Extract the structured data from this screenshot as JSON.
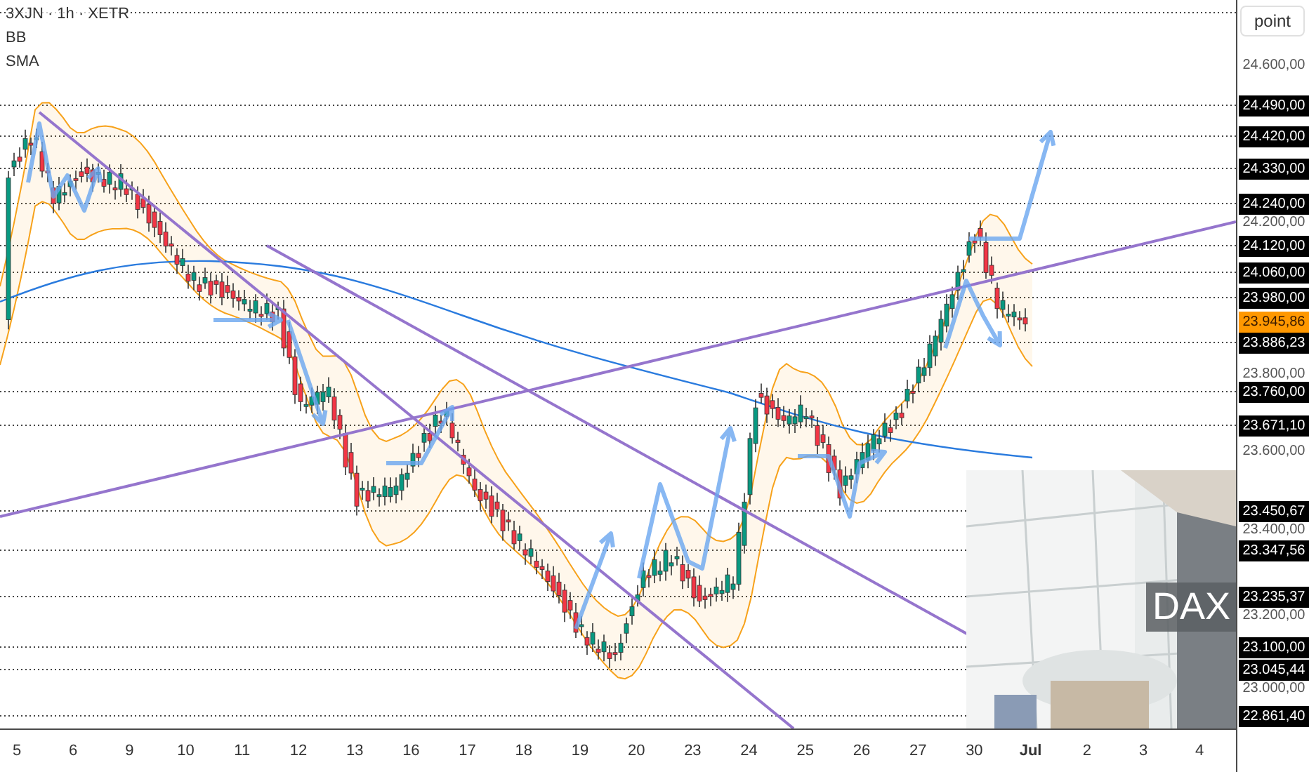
{
  "legend": {
    "symbol": "3XJN · 1h · XETR",
    "indicators": [
      "BB",
      "SMA"
    ]
  },
  "price_axis": {
    "unit": "point",
    "labels": [
      {
        "text": "24.600,00",
        "kind": "tick"
      },
      {
        "text": "24.490,00",
        "kind": "level"
      },
      {
        "text": "24.420,00",
        "kind": "level"
      },
      {
        "text": "24.330,00",
        "kind": "level"
      },
      {
        "text": "24.240,00",
        "kind": "level"
      },
      {
        "text": "24.200,00",
        "kind": "tick"
      },
      {
        "text": "24.120,00",
        "kind": "level"
      },
      {
        "text": "24.060,00",
        "kind": "level"
      },
      {
        "text": "23.980,00",
        "kind": "level"
      },
      {
        "text": "23.945,86",
        "kind": "current"
      },
      {
        "text": "23.886,23",
        "kind": "level"
      },
      {
        "text": "23.800,00",
        "kind": "tick"
      },
      {
        "text": "23.760,00",
        "kind": "level"
      },
      {
        "text": "23.671,10",
        "kind": "level"
      },
      {
        "text": "23.600,00",
        "kind": "tick"
      },
      {
        "text": "23.450,67",
        "kind": "level"
      },
      {
        "text": "23.400,00",
        "kind": "tick"
      },
      {
        "text": "23.347,56",
        "kind": "level"
      },
      {
        "text": "23.235,37",
        "kind": "level"
      },
      {
        "text": "23.200,00",
        "kind": "tick"
      },
      {
        "text": "23.100,00",
        "kind": "level"
      },
      {
        "text": "23.045,44",
        "kind": "level"
      },
      {
        "text": "23.000,00",
        "kind": "tick"
      },
      {
        "text": "22.861,40",
        "kind": "level"
      }
    ]
  },
  "time_axis": {
    "labels": [
      {
        "text": "5",
        "kind": "day"
      },
      {
        "text": "6",
        "kind": "day"
      },
      {
        "text": "9",
        "kind": "day"
      },
      {
        "text": "10",
        "kind": "day"
      },
      {
        "text": "11",
        "kind": "day"
      },
      {
        "text": "12",
        "kind": "day"
      },
      {
        "text": "13",
        "kind": "day"
      },
      {
        "text": "16",
        "kind": "day"
      },
      {
        "text": "17",
        "kind": "day"
      },
      {
        "text": "18",
        "kind": "day"
      },
      {
        "text": "19",
        "kind": "day"
      },
      {
        "text": "20",
        "kind": "day"
      },
      {
        "text": "23",
        "kind": "day"
      },
      {
        "text": "24",
        "kind": "day"
      },
      {
        "text": "25",
        "kind": "day"
      },
      {
        "text": "26",
        "kind": "day"
      },
      {
        "text": "27",
        "kind": "day"
      },
      {
        "text": "30",
        "kind": "day"
      },
      {
        "text": "Jul",
        "kind": "month"
      },
      {
        "text": "2",
        "kind": "day"
      },
      {
        "text": "3",
        "kind": "day"
      },
      {
        "text": "4",
        "kind": "day"
      }
    ]
  },
  "overlay_picture": {
    "kind": "picture",
    "label": "DAX"
  }
}
